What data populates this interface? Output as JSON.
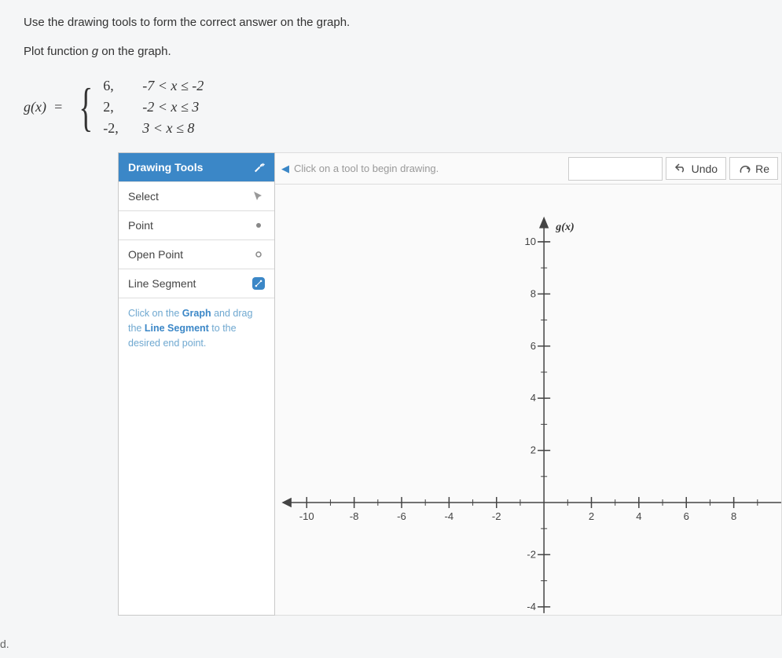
{
  "instructions": {
    "line1": "Use the drawing tools to form the correct answer on the graph.",
    "line2": "Plot function g on the graph."
  },
  "formula": {
    "lhs": "g(x) = ",
    "cases": [
      {
        "value": "6,",
        "condition": "-7 < x ≤ -2"
      },
      {
        "value": "2,",
        "condition": "-2 < x ≤ 3"
      },
      {
        "value": "-2,",
        "condition": "3 < x ≤ 8"
      }
    ]
  },
  "toolbox": {
    "header": "Drawing Tools",
    "items": [
      {
        "name": "select",
        "label": "Select"
      },
      {
        "name": "point",
        "label": "Point"
      },
      {
        "name": "open-point",
        "label": "Open Point"
      },
      {
        "name": "line-segment",
        "label": "Line Segment",
        "selected": true
      }
    ],
    "hint_prefix": "Click on the ",
    "hint_graph": "Graph",
    "hint_mid": " and drag the ",
    "hint_tool": "Line Segment",
    "hint_suffix": " to the desired end point."
  },
  "topbar": {
    "hint": "Click on a tool to begin drawing.",
    "undo": "Undo",
    "redo": "Re"
  },
  "graph": {
    "axis_label": "g(x)",
    "x_ticks": [
      "-10",
      "-8",
      "-6",
      "-4",
      "-2",
      "2",
      "4",
      "6",
      "8"
    ],
    "y_ticks": [
      "10",
      "8",
      "6",
      "4",
      "2",
      "-2",
      "-4"
    ]
  },
  "footer": "d."
}
